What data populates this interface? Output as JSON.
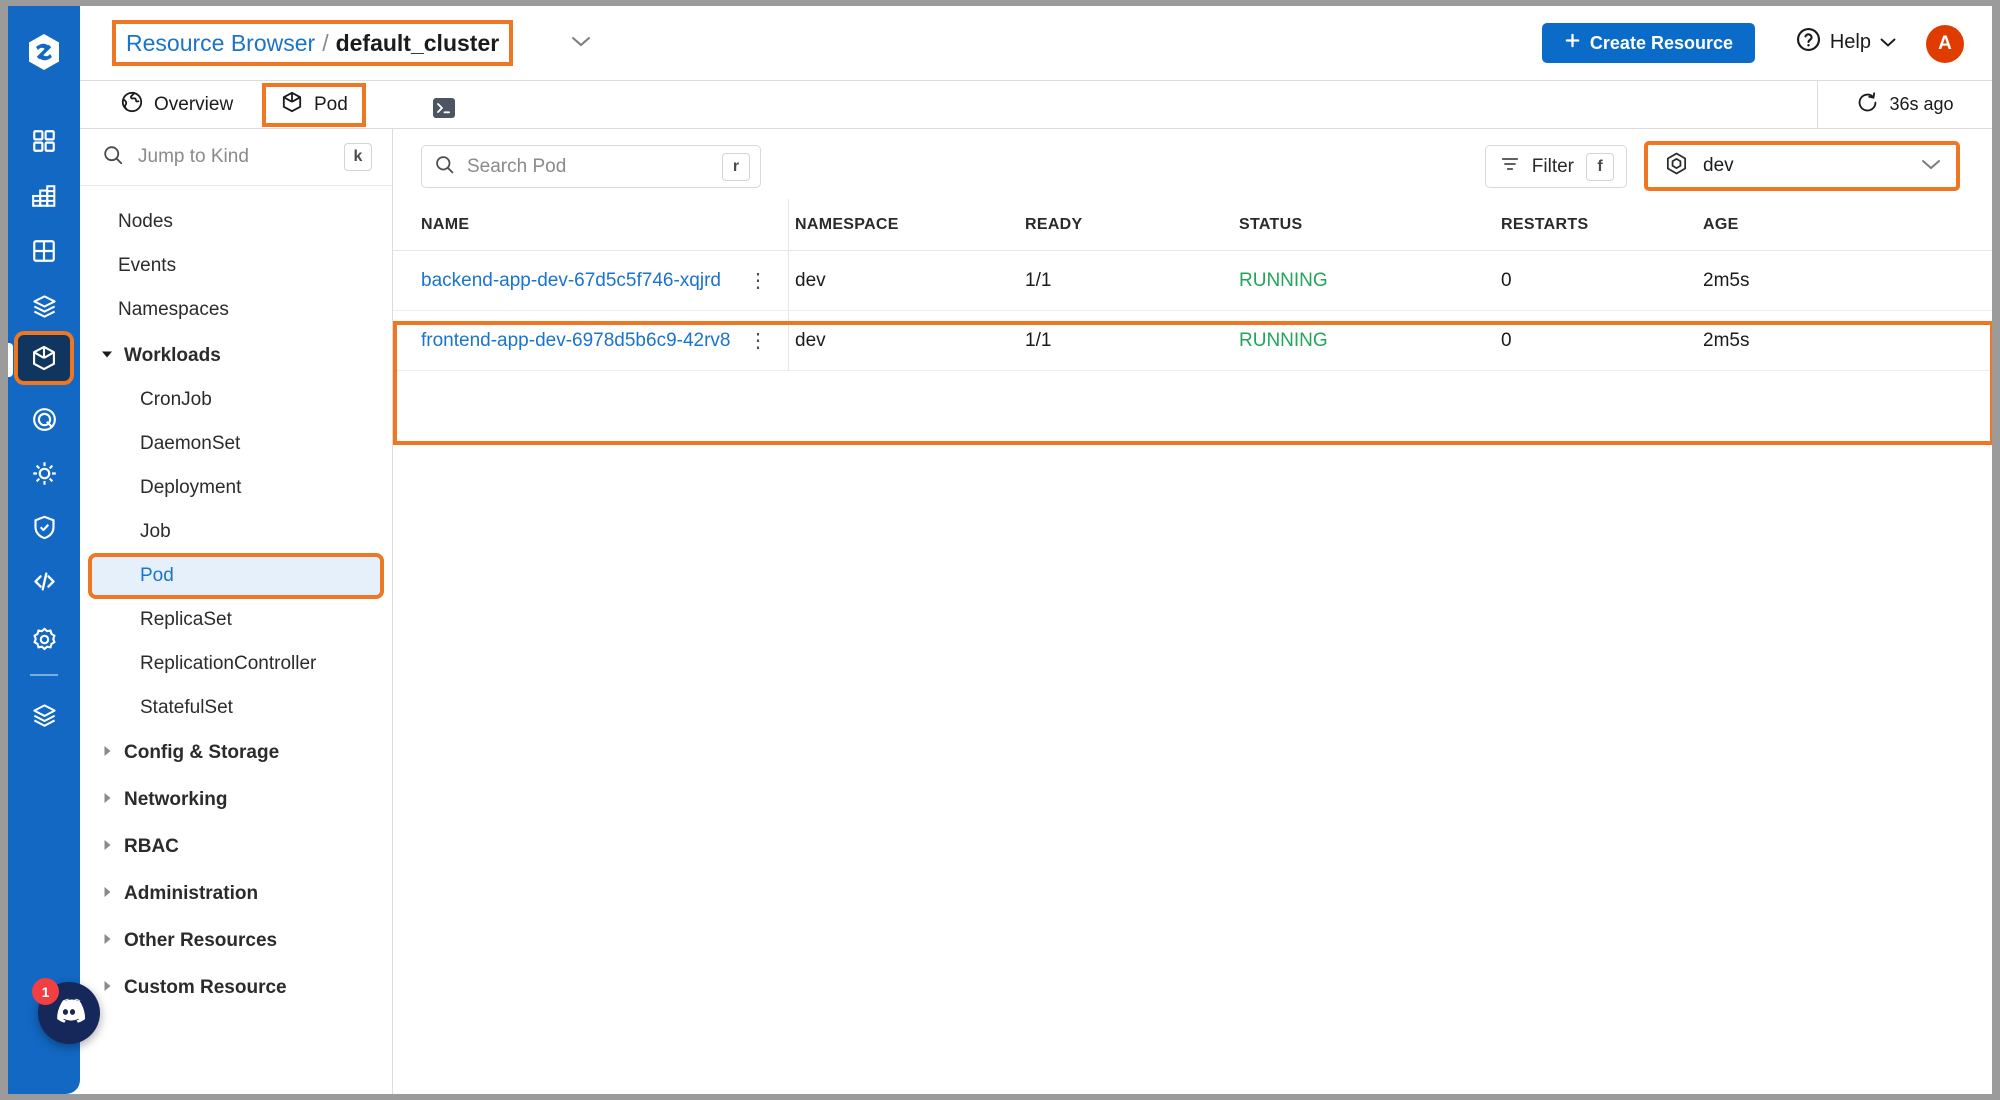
{
  "rail": {
    "logo_icon": "app-logo-icon",
    "items": [
      {
        "icon": "dashboard-grid-icon",
        "name": "dashboard"
      },
      {
        "icon": "bar-chart-grid-icon",
        "name": "metrics"
      },
      {
        "icon": "table-grid-icon",
        "name": "tables"
      },
      {
        "icon": "stacked-boxes-icon",
        "name": "packages"
      },
      {
        "icon": "cube-icon",
        "name": "resource-browser",
        "active": true
      },
      {
        "icon": "target-circle-icon",
        "name": "targets"
      },
      {
        "icon": "helm-wheel-icon",
        "name": "helm"
      },
      {
        "icon": "shield-check-icon",
        "name": "security"
      },
      {
        "icon": "code-brackets-icon",
        "name": "code"
      },
      {
        "icon": "gear-icon",
        "name": "settings"
      },
      {
        "icon": "layers-icon",
        "name": "layers"
      }
    ],
    "discord": {
      "icon": "discord-icon",
      "badge": "1"
    }
  },
  "header": {
    "breadcrumb": {
      "link": "Resource Browser",
      "separator": "/",
      "current": "default_cluster",
      "caret_icon": "chevron-down-icon"
    },
    "create_button": {
      "label": "Create Resource",
      "icon": "plus-icon",
      "color": "#0b6bc9"
    },
    "help": {
      "label": "Help",
      "icon": "question-circle-icon",
      "caret_icon": "chevron-down-icon"
    },
    "avatar": {
      "initial": "A",
      "color": "#e03c00"
    }
  },
  "tabs": {
    "overview": {
      "label": "Overview",
      "icon": "globe-icon"
    },
    "pod": {
      "label": "Pod",
      "icon": "cube-icon",
      "selected": true
    },
    "terminal": {
      "icon": "terminal-icon"
    },
    "refresh": {
      "label": "36s ago",
      "icon": "refresh-icon"
    }
  },
  "sidebar": {
    "jump": {
      "placeholder": "Jump to Kind",
      "icon": "search-icon",
      "shortcut": "k"
    },
    "items": [
      {
        "label": "Nodes",
        "level": 0
      },
      {
        "label": "Events",
        "level": 0
      },
      {
        "label": "Namespaces",
        "level": 0
      },
      {
        "label": "Workloads",
        "level": "group",
        "expanded": true
      },
      {
        "label": "CronJob",
        "level": 1
      },
      {
        "label": "DaemonSet",
        "level": 1
      },
      {
        "label": "Deployment",
        "level": 1
      },
      {
        "label": "Job",
        "level": 1
      },
      {
        "label": "Pod",
        "level": 1,
        "selected": true
      },
      {
        "label": "ReplicaSet",
        "level": 1
      },
      {
        "label": "ReplicationController",
        "level": 1
      },
      {
        "label": "StatefulSet",
        "level": 1
      },
      {
        "label": "Config & Storage",
        "level": "group",
        "expanded": false
      },
      {
        "label": "Networking",
        "level": "group",
        "expanded": false
      },
      {
        "label": "RBAC",
        "level": "group",
        "expanded": false
      },
      {
        "label": "Administration",
        "level": "group",
        "expanded": false
      },
      {
        "label": "Other Resources",
        "level": "group",
        "expanded": false
      },
      {
        "label": "Custom Resource",
        "level": "group",
        "expanded": false
      }
    ]
  },
  "toolbar": {
    "search": {
      "placeholder": "Search Pod",
      "icon": "search-icon",
      "shortcut": "r"
    },
    "filter": {
      "label": "Filter",
      "icon": "filter-icon",
      "shortcut": "f"
    },
    "namespace": {
      "value": "dev",
      "icon": "hexagon-namespace-icon",
      "caret_icon": "chevron-down-icon"
    }
  },
  "table": {
    "columns": [
      "NAME",
      "NAMESPACE",
      "READY",
      "STATUS",
      "RESTARTS",
      "AGE"
    ],
    "rows": [
      {
        "name": "backend-app-dev-67d5c5f746-xqjrd",
        "namespace": "dev",
        "ready": "1/1",
        "status": "RUNNING",
        "restarts": "0",
        "age": "2m5s",
        "menu_icon": "kebab-menu-icon"
      },
      {
        "name": "frontend-app-dev-6978d5b6c9-42rv8",
        "namespace": "dev",
        "ready": "1/1",
        "status": "RUNNING",
        "restarts": "0",
        "age": "2m5s",
        "menu_icon": "kebab-menu-icon"
      }
    ],
    "status_color": "#23a55a",
    "link_color": "#1a73cc"
  },
  "accent": {
    "highlight": "#ef7622",
    "brand": "#1268c3"
  }
}
